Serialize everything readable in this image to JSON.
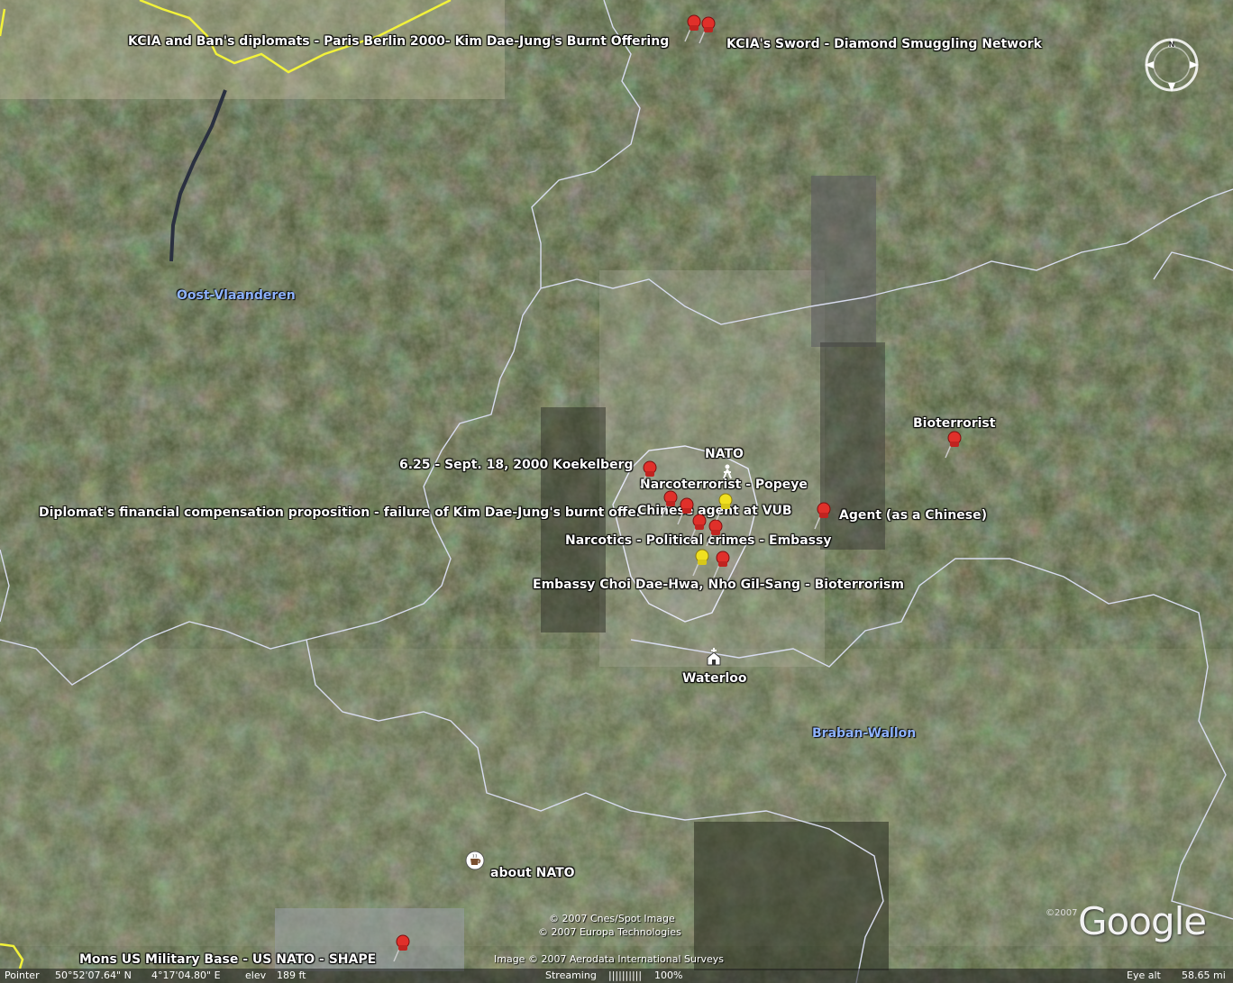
{
  "placemarks": {
    "kcia_ban": "KCIA and Ban's diplomats  - Paris Berlin 2000- Kim Dae-Jung's Burnt Offering",
    "kcia_sword": "KCIA's Sword - Diamond Smuggling Network",
    "koekelberg": "6.25 - Sept. 18, 2000 Koekelberg",
    "nato": "NATO",
    "popeye": "Narcoterrorist - Popeye",
    "diplomat_comp": "Diplomat's financial compensation proposition - failure of Kim Dae-Jung's burnt offering",
    "chinese_vub": "Chinese agent at VUB",
    "agent_chinese": "Agent (as a Chinese)",
    "narcotics": "Narcotics - Political crimes - Embassy",
    "embassy_choi": "Embassy Choi Dae-Hwa, Nho Gil-Sang - Bioterrorism",
    "bioterrorist": "Bioterrorist",
    "waterloo": "Waterloo",
    "about_nato": "about NATO",
    "mons": "Mons US Military Base - US NATO - SHAPE"
  },
  "regions": {
    "oost_vlaanderen": "Oost-Vlaanderen",
    "brabant_wallon": "Braban-Wallon"
  },
  "credits": {
    "line1": "© 2007 Cnes/Spot Image",
    "line2": "© 2007 Europa Technologies",
    "line3": "Image © 2007 Aerodata International Surveys",
    "logo": "Google",
    "logo_year": "©2007"
  },
  "compass": {
    "north_label": "N"
  },
  "status": {
    "pointer_label": "Pointer",
    "lat": "50°52'07.64\" N",
    "lon": "4°17'04.80\" E",
    "elev_label": "elev",
    "elev_value": "189 ft",
    "streaming_label": "Streaming",
    "streaming_bars": "||||||||||",
    "streaming_pct": "100%",
    "eye_alt_label": "Eye alt",
    "eye_alt_value": "58.65 mi"
  },
  "colors": {
    "pin_red": "#e0302a",
    "pin_yellow": "#f0e020",
    "border_province": "#f2f23a",
    "border_line": "#d8dcf0"
  }
}
